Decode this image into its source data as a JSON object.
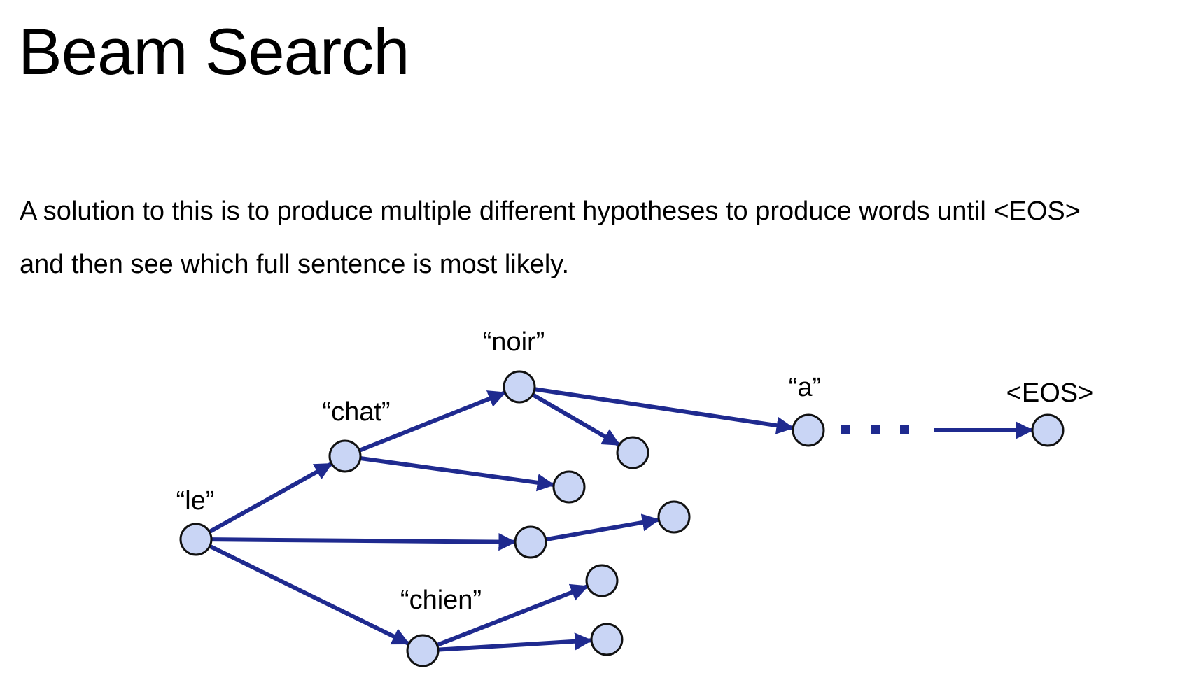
{
  "slide": {
    "title": "Beam Search",
    "body_lines": [
      "A solution to this is to produce multiple different hypotheses to produce words until <EOS>",
      "and then see which full sentence is most likely."
    ]
  },
  "diagram": {
    "colors": {
      "edge": "#1f2a8f",
      "node_fill": "#c9d5f5",
      "node_stroke": "#111111"
    },
    "nodes": [
      {
        "id": "le",
        "label": "“le”"
      },
      {
        "id": "chat",
        "label": "“chat”"
      },
      {
        "id": "noir",
        "label": "“noir”"
      },
      {
        "id": "a",
        "label": "“a”"
      },
      {
        "id": "eos",
        "label": "<EOS>"
      },
      {
        "id": "chien",
        "label": "“chien”"
      },
      {
        "id": "noir_child",
        "label": ""
      },
      {
        "id": "chat_child",
        "label": ""
      },
      {
        "id": "le_mid",
        "label": ""
      },
      {
        "id": "le_mid_child",
        "label": ""
      },
      {
        "id": "chien_child_1",
        "label": ""
      },
      {
        "id": "chien_child_2",
        "label": ""
      }
    ],
    "edges": [
      {
        "from": "le",
        "to": "chat"
      },
      {
        "from": "le",
        "to": "le_mid"
      },
      {
        "from": "le",
        "to": "chien"
      },
      {
        "from": "chat",
        "to": "noir"
      },
      {
        "from": "chat",
        "to": "chat_child"
      },
      {
        "from": "noir",
        "to": "a"
      },
      {
        "from": "noir",
        "to": "noir_child"
      },
      {
        "from": "le_mid",
        "to": "le_mid_child"
      },
      {
        "from": "chien",
        "to": "chien_child_1"
      },
      {
        "from": "chien",
        "to": "chien_child_2"
      },
      {
        "from": "a",
        "to": "eos",
        "style": "ellipsis"
      }
    ]
  }
}
